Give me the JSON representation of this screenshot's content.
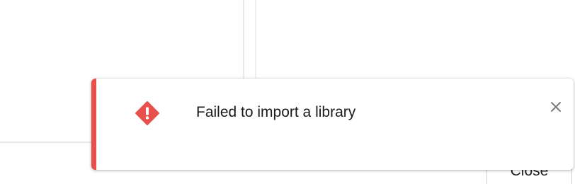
{
  "toast": {
    "message": "Failed to import a library",
    "type": "error",
    "icon": "error-diamond-icon",
    "close_icon": "close-icon",
    "accent_color": "#e8504b"
  },
  "footer": {
    "close_button_label": "Close"
  }
}
